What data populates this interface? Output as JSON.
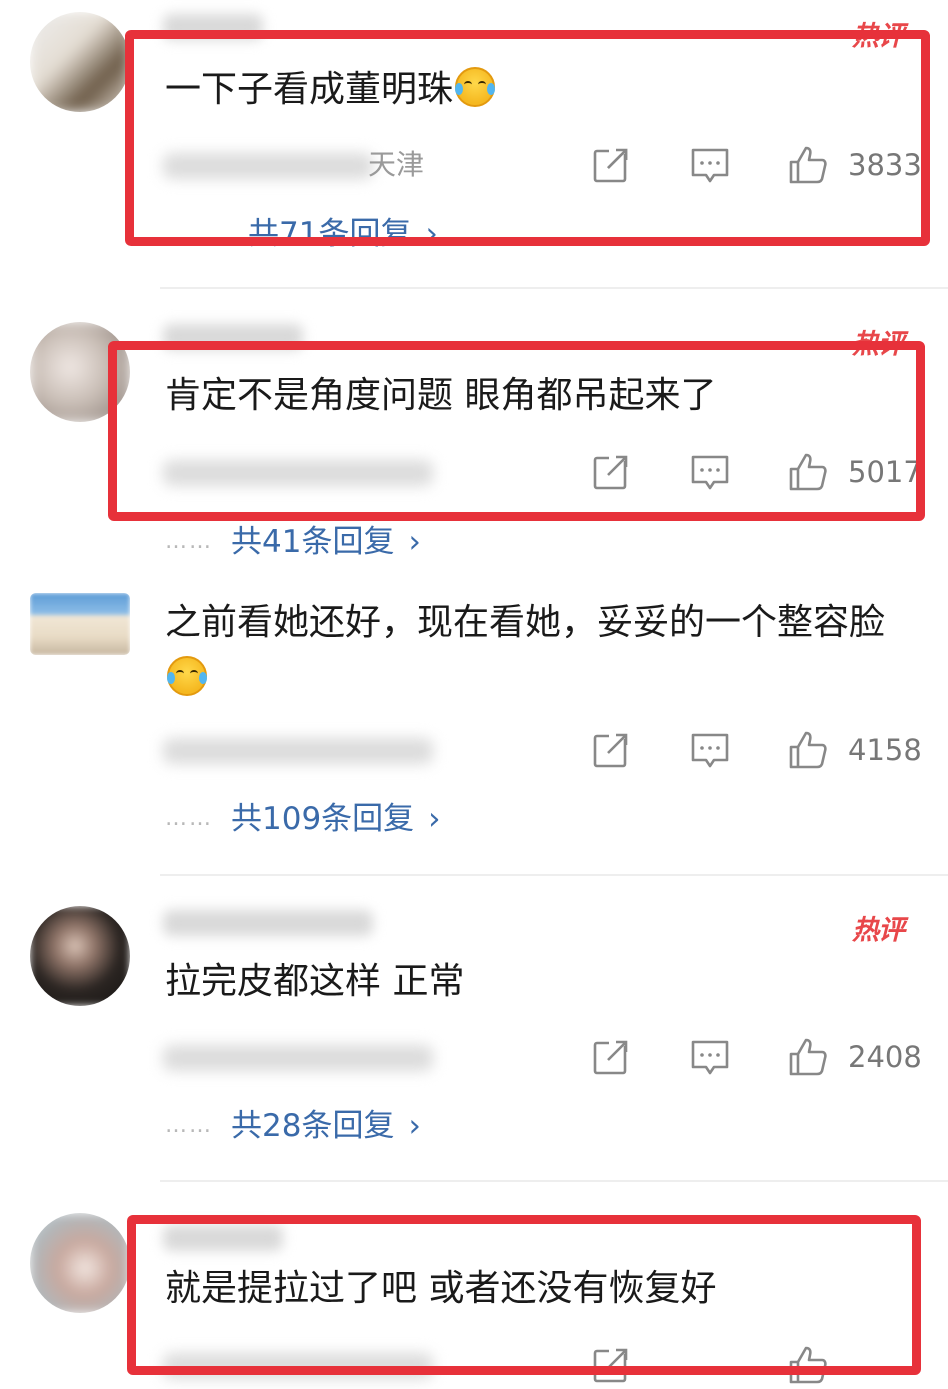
{
  "comments": [
    {
      "text": "一下子看成董明珠",
      "hot_label": "热评",
      "location": "天津",
      "likes": "3833",
      "replies": "共71条回复"
    },
    {
      "text": "肯定不是角度问题 眼角都吊起来了",
      "hot_label": "热评",
      "location": "",
      "likes": "5017",
      "replies": "共41条回复"
    },
    {
      "text": "之前看她还好，现在看她，妥妥的一个整容脸",
      "location": "",
      "likes": "4158",
      "replies": "共109条回复"
    },
    {
      "text": "拉完皮都这样 正常",
      "hot_label": "热评",
      "location": "",
      "likes": "2408",
      "replies": "共28条回复"
    },
    {
      "text": "就是提拉过了吧 或者还没有恢复好",
      "location": "",
      "likes": "",
      "replies": ""
    }
  ],
  "ui": {
    "reply_dots": "……",
    "reply_arrow": "›"
  },
  "colors": {
    "highlight_box": "#e7313a",
    "hot_badge": "#e8474a",
    "reply_link": "#3a6aa9",
    "meta_text": "#9a9a9a"
  },
  "icons": [
    "share-icon",
    "reply-icon",
    "thumbs-up-icon",
    "laughing-crying-emoji"
  ]
}
